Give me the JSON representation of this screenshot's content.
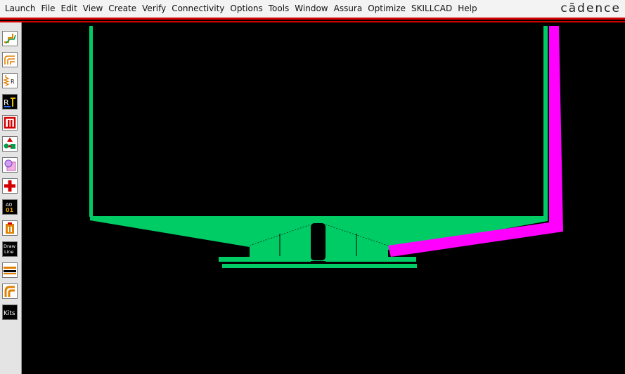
{
  "menubar": {
    "items": [
      "Launch",
      "File",
      "Edit",
      "View",
      "Create",
      "Verify",
      "Connectivity",
      "Options",
      "Tools",
      "Window",
      "Assura",
      "Optimize",
      "SKILLCAD",
      "Help"
    ]
  },
  "brand": "cādence",
  "toolbar": {
    "draw_line_label": "Draw\nLine",
    "kits_label": "Kits",
    "a01_label": "A0\n01"
  },
  "colors": {
    "background": "#000000",
    "metal_green": "#00cc66",
    "metal_magenta": "#ff00ff",
    "accent_red": "#d40000"
  }
}
